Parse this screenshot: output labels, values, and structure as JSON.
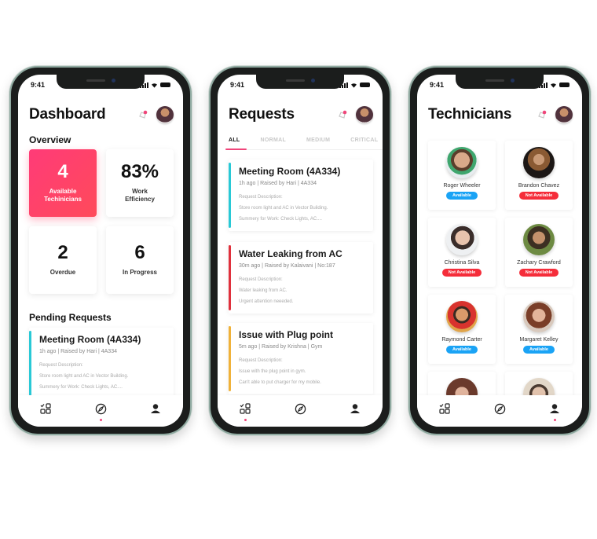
{
  "status_bar": {
    "time": "9:41"
  },
  "colors": {
    "accent": "#f0457a",
    "available": "#1aa3f5",
    "not_available": "#f52d3a",
    "normal_bar": "#29c9d6",
    "critical_bar": "#e0313d",
    "medium_bar": "#f0b23a"
  },
  "dashboard": {
    "title": "Dashboard",
    "overview_title": "Overview",
    "stats": [
      {
        "value": "4",
        "label": "Available Techinicians",
        "highlight": true
      },
      {
        "value": "83%",
        "label": "Work Efficiency"
      },
      {
        "value": "2",
        "label": "Overdue"
      },
      {
        "value": "6",
        "label": "In Progress"
      }
    ],
    "pending_title": "Pending Requests",
    "pending": {
      "title": "Meeting Room (4A334)",
      "meta": "1h ago  |  Raised by Hari  | 4A334",
      "desc_label": "Request Description:",
      "line1": "Store room light and AC in Vector Building.",
      "line2": "Summery for Work: Check Lights, AC...."
    }
  },
  "requests": {
    "title": "Requests",
    "tabs": [
      "ALL",
      "NORMAL",
      "MEDIUM",
      "CRITICAL"
    ],
    "active_tab": "ALL",
    "items": [
      {
        "title": "Meeting Room (4A334)",
        "meta": "1h ago  |  Raised by Hari  | 4A334",
        "desc_label": "Request Description:",
        "line1": "Store room light and AC in Vector Building.",
        "line2": "Summery for Work: Check Lights, AC...."
      },
      {
        "title": "Water Leaking from AC",
        "meta": "30m ago  |  Raised by Kalaivani  | No:187",
        "desc_label": "Request Description:",
        "line1": "Water leaking from AC.",
        "line2": "Urgent attention neeeded."
      },
      {
        "title": "Issue with Plug point",
        "meta": "5m ago  | Raised by Krishna  | Gym",
        "desc_label": "Request Description:",
        "line1": "Issue with the plug point in gym.",
        "line2": "Can't able to put charger for my mobile."
      }
    ]
  },
  "technicians": {
    "title": "Technicians",
    "list": [
      {
        "name": "Roger Wheeler",
        "status": "Available"
      },
      {
        "name": "Brandon Chavez",
        "status": "Not Available"
      },
      {
        "name": "Christina Silva",
        "status": "Not Available"
      },
      {
        "name": "Zachary Crawford",
        "status": "Not Available"
      },
      {
        "name": "Raymond Carter",
        "status": "Available"
      },
      {
        "name": "Margaret Kelley",
        "status": "Available"
      }
    ]
  },
  "nav": {
    "items": [
      "tasks-icon",
      "explore-icon",
      "profile-icon"
    ]
  }
}
